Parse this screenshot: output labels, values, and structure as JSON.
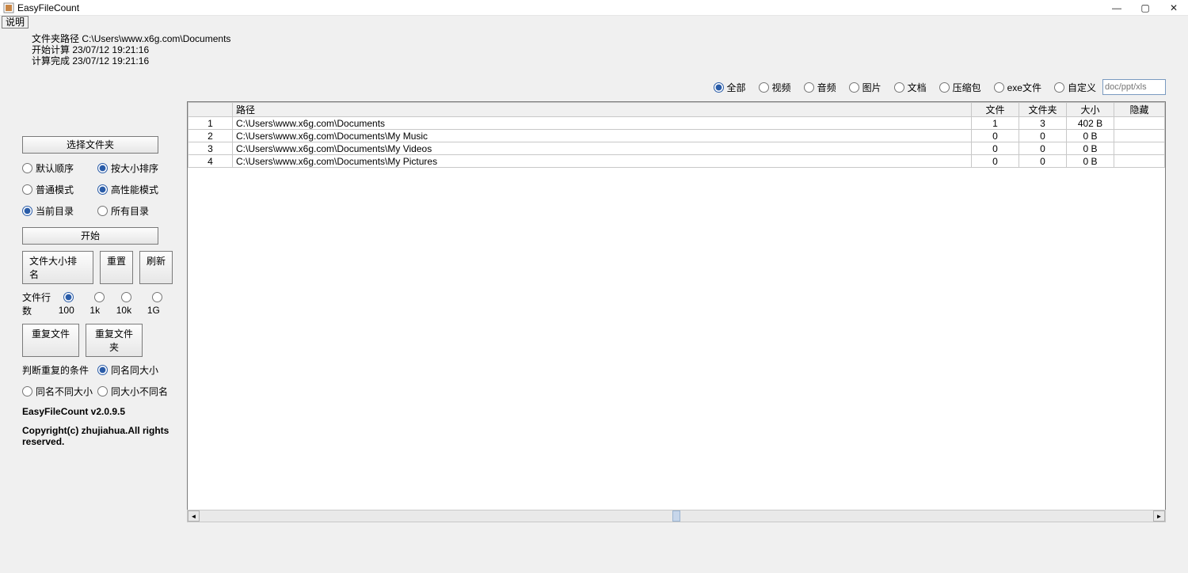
{
  "window": {
    "title": "EasyFileCount",
    "min": "—",
    "max": "▢",
    "close": "✕"
  },
  "menu": {
    "help": "说明"
  },
  "info": {
    "line1_label": "文件夹路径",
    "line1_value": "C:\\Users\\www.x6g.com\\Documents",
    "line2_label": "开始计算",
    "line2_value": "23/07/12 19:21:16",
    "line3_label": "计算完成",
    "line3_value": "23/07/12 19:21:16"
  },
  "filters": {
    "all": "全部",
    "video": "视频",
    "audio": "音频",
    "image": "图片",
    "doc": "文档",
    "archive": "压缩包",
    "exe": "exe文件",
    "custom": "自定义",
    "custom_placeholder": "doc/ppt/xls"
  },
  "sidebar": {
    "select_folder": "选择文件夹",
    "sort_default": "默认顺序",
    "sort_size": "按大小排序",
    "mode_normal": "普通模式",
    "mode_hp": "高性能模式",
    "scope_current": "当前目录",
    "scope_all": "所有目录",
    "start": "开始",
    "btn_filesize": "文件大小排名",
    "btn_reset": "重置",
    "btn_refresh": "刷新",
    "rows_label": "文件行数",
    "rows_100": "100",
    "rows_1k": "1k",
    "rows_10k": "10k",
    "rows_1g": "1G",
    "dup_file": "重复文件",
    "dup_folder": "重复文件夹",
    "dup_cond_label": "判断重复的条件",
    "dup_cond_namesize": "同名同大小",
    "dup_cond_name": "同名不同大小",
    "dup_cond_size": "同大小不同名",
    "version": "EasyFileCount v2.0.9.5",
    "copyright": "Copyright(c) zhujiahua.All rights reserved."
  },
  "columns": {
    "path": "路径",
    "files": "文件",
    "folders": "文件夹",
    "size": "大小",
    "hidden": "隐藏"
  },
  "rows": [
    {
      "idx": "1",
      "path": "C:\\Users\\www.x6g.com\\Documents",
      "files": "1",
      "folders": "3",
      "size": "402 B",
      "hidden": ""
    },
    {
      "idx": "2",
      "path": "C:\\Users\\www.x6g.com\\Documents\\My Music",
      "files": "0",
      "folders": "0",
      "size": "0 B",
      "hidden": ""
    },
    {
      "idx": "3",
      "path": "C:\\Users\\www.x6g.com\\Documents\\My Videos",
      "files": "0",
      "folders": "0",
      "size": "0 B",
      "hidden": ""
    },
    {
      "idx": "4",
      "path": "C:\\Users\\www.x6g.com\\Documents\\My Pictures",
      "files": "0",
      "folders": "0",
      "size": "0 B",
      "hidden": ""
    }
  ]
}
